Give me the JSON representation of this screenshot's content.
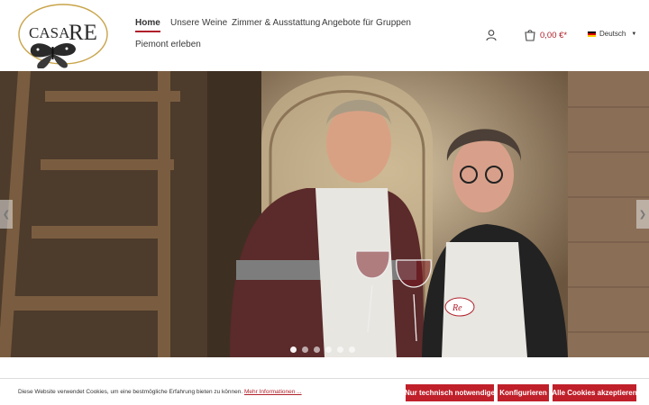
{
  "brand": {
    "logo_text_left": "CASA",
    "logo_text_right": "RE"
  },
  "nav": {
    "items": [
      {
        "label": "Home",
        "active": true
      },
      {
        "label": "Unsere Weine"
      },
      {
        "label": "Zimmer & Ausstattung"
      },
      {
        "label": "Angebote für Gruppen"
      },
      {
        "label": "Piemont erleben"
      }
    ]
  },
  "header": {
    "account_icon": "user-icon",
    "cart_icon": "shopping-bag-icon",
    "cart_total": "0,00 €*",
    "language": "Deutsch"
  },
  "hero": {
    "slides_count": 6,
    "active_slide": 1,
    "apron_logo": "Re"
  },
  "cookie": {
    "text": "Diese Website verwendet Cookies, um eine bestmögliche Erfahrung bieten zu können.",
    "link": "Mehr Informationen ...",
    "btn_necessary": "Nur technisch notwendige",
    "btn_configure": "Konfigurieren",
    "btn_accept": "Alle Cookies akzeptieren"
  },
  "colors": {
    "accent": "#b0202a",
    "button": "#c0202a"
  }
}
